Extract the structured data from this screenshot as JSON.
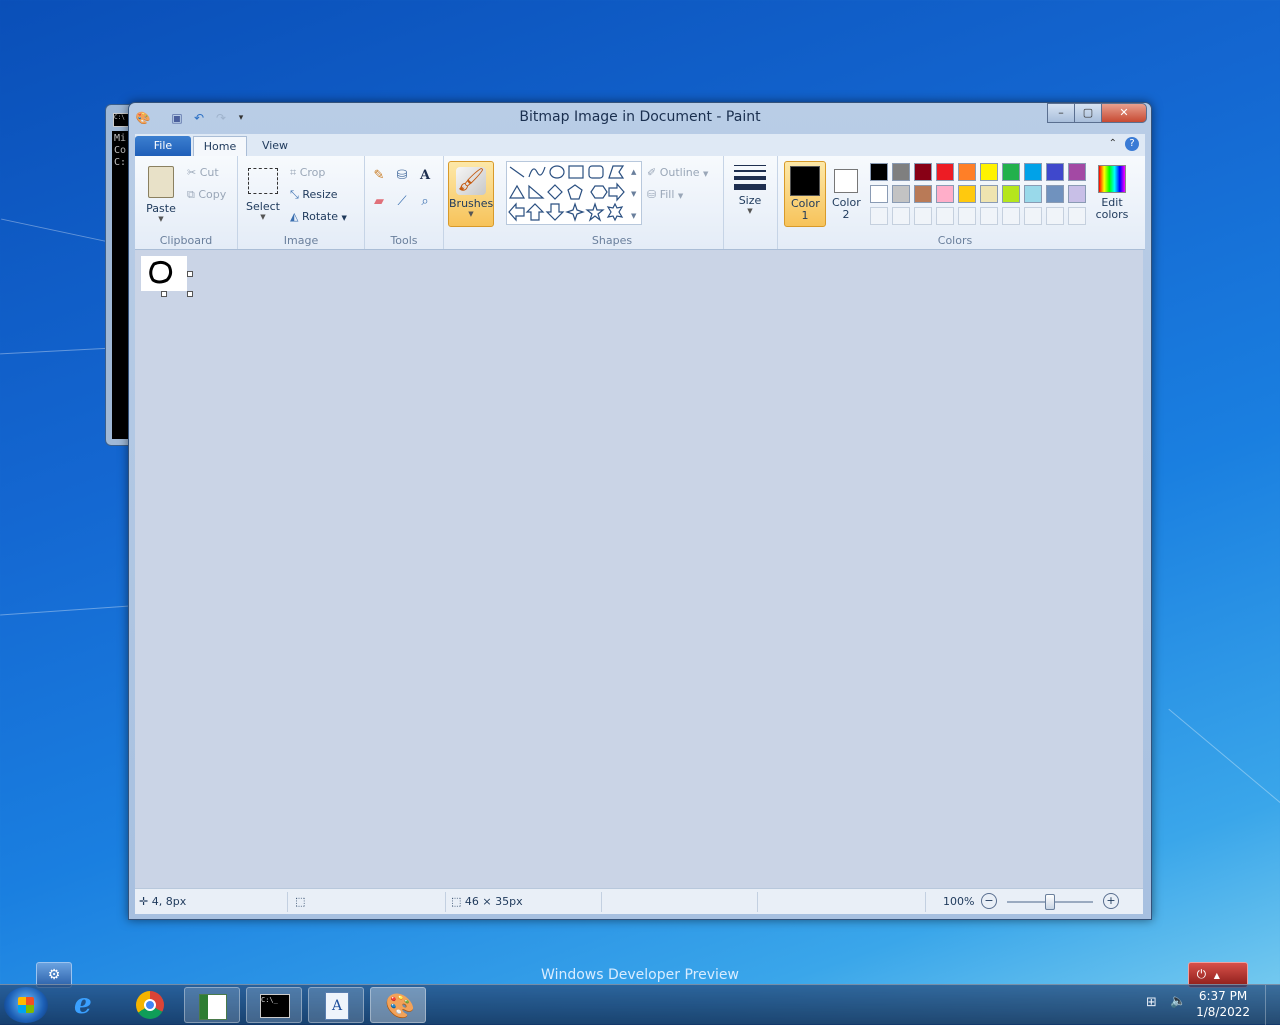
{
  "desktop": {
    "watermark": "Windows Developer Preview"
  },
  "cmd_window": {
    "lines": [
      "Mi",
      "Co",
      "",
      "C:"
    ]
  },
  "paint": {
    "title": "Bitmap Image in Document - Paint",
    "tabs": {
      "file": "File",
      "home": "Home",
      "view": "View"
    },
    "clipboard": {
      "paste": "Paste",
      "cut": "Cut",
      "copy": "Copy",
      "label": "Clipboard"
    },
    "image": {
      "select": "Select",
      "crop": "Crop",
      "resize": "Resize",
      "rotate": "Rotate",
      "label": "Image"
    },
    "tools": {
      "label": "Tools"
    },
    "brushes": {
      "label": "Brushes"
    },
    "shapes": {
      "outline": "Outline",
      "fill": "Fill",
      "label": "Shapes"
    },
    "size": {
      "label": "Size"
    },
    "colors": {
      "color1": "Color 1",
      "color2": "Color 2",
      "edit": "Edit colors",
      "label": "Colors",
      "color1_value": "#000000",
      "color2_value": "#ffffff",
      "palette_row1": [
        "#000000",
        "#7f7f7f",
        "#880015",
        "#ed1c24",
        "#ff7f27",
        "#fff200",
        "#22b14c",
        "#00a2e8",
        "#3f48cc",
        "#a349a4"
      ],
      "palette_row2": [
        "#ffffff",
        "#c3c3c3",
        "#b97a57",
        "#ffaec9",
        "#ffc90e",
        "#efe4b0",
        "#b5e61d",
        "#99d9ea",
        "#7092be",
        "#c8bfe7"
      ]
    },
    "status": {
      "cursor": "4, 8px",
      "selection": "",
      "image_size": "46 × 35px",
      "zoom": "100%"
    }
  },
  "taskbar": {
    "time": "6:37 PM",
    "date": "1/8/2022"
  }
}
